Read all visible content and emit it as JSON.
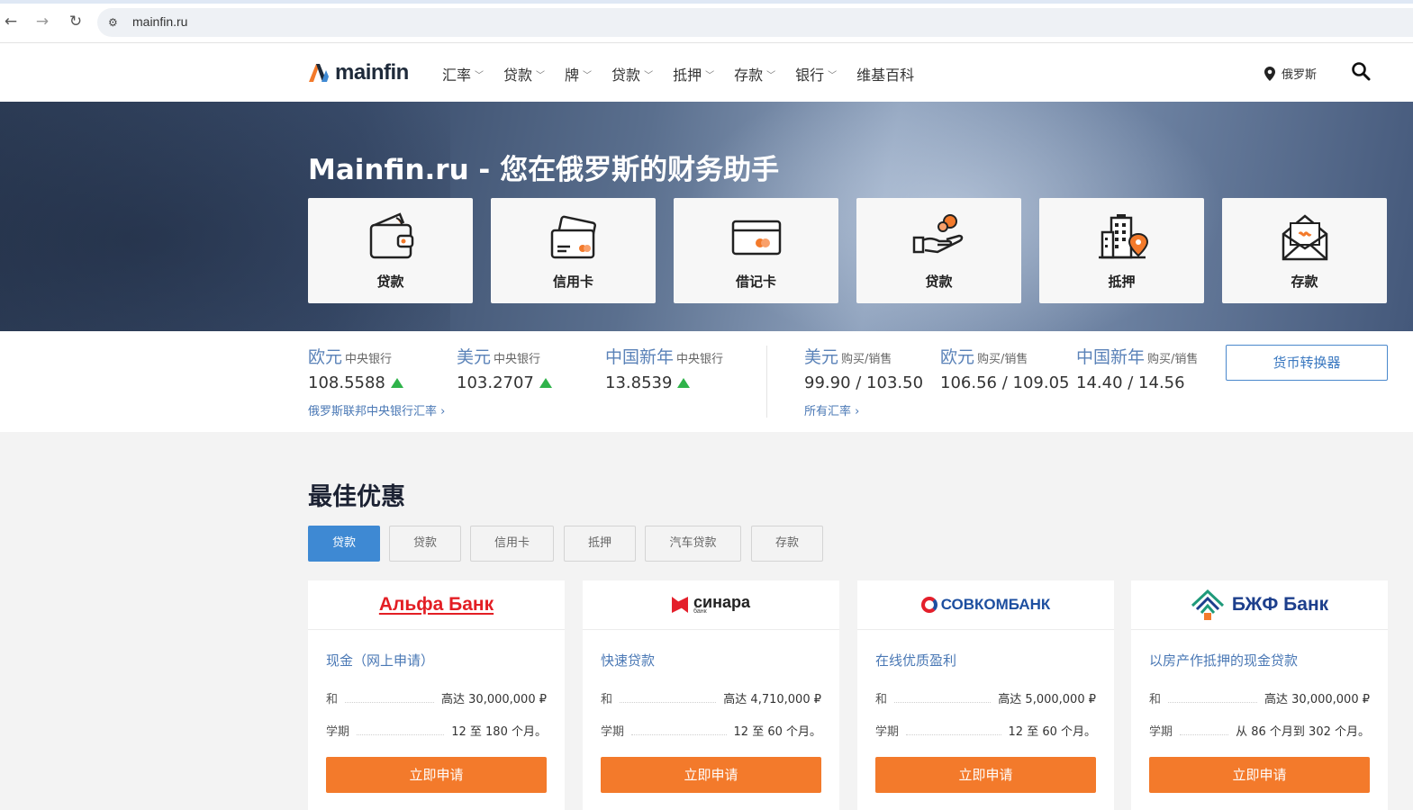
{
  "browser": {
    "url": "mainfin.ru"
  },
  "header": {
    "logo_text": "mainfin",
    "menu": [
      {
        "label": "汇率"
      },
      {
        "label": "贷款"
      },
      {
        "label": "牌"
      },
      {
        "label": "贷款"
      },
      {
        "label": "抵押"
      },
      {
        "label": "存款"
      },
      {
        "label": "银行"
      },
      {
        "label": "维基百科"
      }
    ],
    "location": "俄罗斯"
  },
  "hero": {
    "title": "Mainfin.ru - 您在俄罗斯的财务助手",
    "tiles": [
      {
        "label": "贷款",
        "icon": "wallet-icon"
      },
      {
        "label": "信用卡",
        "icon": "credit-card-icon"
      },
      {
        "label": "借记卡",
        "icon": "debit-card-icon"
      },
      {
        "label": "贷款",
        "icon": "hand-coin-icon"
      },
      {
        "label": "抵押",
        "icon": "building-location-icon"
      },
      {
        "label": "存款",
        "icon": "envelope-money-icon"
      }
    ]
  },
  "rates": {
    "cb": [
      {
        "currency": "欧元",
        "source": "中央银行",
        "value": "108.5588",
        "trend": "up"
      },
      {
        "currency": "美元",
        "source": "中央银行",
        "value": "103.2707",
        "trend": "up"
      },
      {
        "currency": "中国新年",
        "source": "中央银行",
        "value": "13.8539",
        "trend": "up"
      }
    ],
    "cb_link": "俄罗斯联邦中央银行汇率",
    "exchange": [
      {
        "currency": "美元",
        "source": "购买/销售",
        "value": "99.90 / 103.50"
      },
      {
        "currency": "欧元",
        "source": "购买/销售",
        "value": "106.56 / 109.05"
      },
      {
        "currency": "中国新年",
        "source": "购买/销售",
        "value": "14.40 / 14.56"
      }
    ],
    "exchange_link": "所有汇率",
    "converter_label": "货币转换器",
    "up_color": "#2fb34a"
  },
  "offers": {
    "title": "最佳优惠",
    "filters": [
      {
        "label": "贷款",
        "active": true
      },
      {
        "label": "贷款",
        "active": false
      },
      {
        "label": "信用卡",
        "active": false
      },
      {
        "label": "抵押",
        "active": false
      },
      {
        "label": "汽车贷款",
        "active": false
      },
      {
        "label": "存款",
        "active": false
      }
    ],
    "cards": [
      {
        "bank": "Альфа Банк",
        "title": "现金（网上申请）",
        "amount_label": "和",
        "amount": "高达 30,000,000 ₽",
        "term_label": "学期",
        "term": "12 至 180 个月。",
        "apply": "立即申请"
      },
      {
        "bank": "синара",
        "bank_sub": "банк",
        "title": "快速贷款",
        "amount_label": "和",
        "amount": "高达 4,710,000 ₽",
        "term_label": "学期",
        "term": "12 至 60 个月。",
        "apply": "立即申请"
      },
      {
        "bank": "СОВКОМБАНК",
        "title": "在线优质盈利",
        "amount_label": "和",
        "amount": "高达 5,000,000 ₽",
        "term_label": "学期",
        "term": "12 至 60 个月。",
        "apply": "立即申请"
      },
      {
        "bank": "БЖФ Банк",
        "title": "以房产作抵押的现金贷款",
        "amount_label": "和",
        "amount": "高达 30,000,000 ₽",
        "term_label": "学期",
        "term": "从 86 个月到 302 个月。",
        "apply": "立即申请"
      }
    ],
    "accent": "#f37a2b",
    "active_filter_color": "#3e89d3"
  }
}
